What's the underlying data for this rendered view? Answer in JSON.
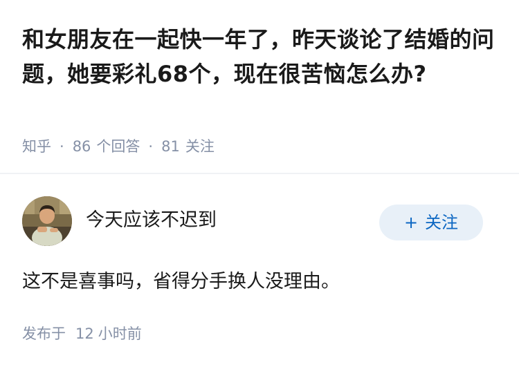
{
  "question": {
    "title": "和女朋友在一起快一年了，昨天谈论了结婚的问题，她要彩礼68个，现在很苦恼怎么办?",
    "source": "知乎",
    "separator": "·",
    "answer_count": "86",
    "answer_label": "个回答",
    "follower_count": "81",
    "follower_label": "关注"
  },
  "answer": {
    "author_name": "今天应该不迟到",
    "avatar_icon": "user-photo-avatar",
    "follow_button": {
      "icon": "plus-icon",
      "plus": "+",
      "label": "关注"
    },
    "content": "这不是喜事吗，省得分手换人没理由。",
    "published_label": "发布于",
    "published_value": "12",
    "published_unit": "小时前"
  },
  "colors": {
    "title": "#1a1a1a",
    "meta": "#8590a6",
    "accent": "#0b66c2",
    "button_bg": "#e8f0f8",
    "divider": "#f0f2f5"
  }
}
